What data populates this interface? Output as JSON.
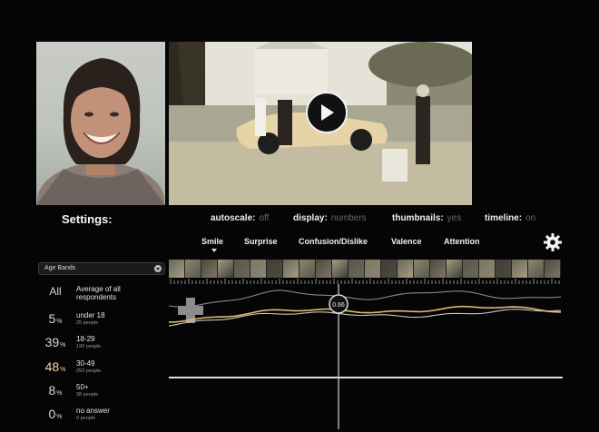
{
  "settings": {
    "title": "Settings:",
    "items": [
      {
        "label": "autoscale:",
        "value": "off"
      },
      {
        "label": "display:",
        "value": "numbers"
      },
      {
        "label": "thumbnails:",
        "value": "yes"
      },
      {
        "label": "timeline:",
        "value": "on"
      }
    ]
  },
  "metrics": {
    "tabs": [
      "Smile",
      "Surprise",
      "Confusion/Dislike",
      "Valence",
      "Attention"
    ],
    "selected": "Smile"
  },
  "filter": {
    "select_label": "Age Bands",
    "bands": [
      {
        "pct": "All",
        "label": "Average of all respondents",
        "sub": ""
      },
      {
        "pct": "5",
        "unit": "%",
        "label": "under 18",
        "sub": "25 people"
      },
      {
        "pct": "39",
        "unit": "%",
        "label": "18-29",
        "sub": "190 people"
      },
      {
        "pct": "48",
        "unit": "%",
        "label": "30-49",
        "sub": "252 people"
      },
      {
        "pct": "8",
        "unit": "%",
        "label": "50+",
        "sub": "38 people"
      },
      {
        "pct": "0",
        "unit": "%",
        "label": "no answer",
        "sub": "0 people"
      }
    ]
  },
  "timeline": {
    "playhead_label": "0.66",
    "playhead_position": 0.43,
    "series_colors": [
      "#8a8a8a",
      "#e6b86f",
      "#c8c8c8"
    ]
  }
}
